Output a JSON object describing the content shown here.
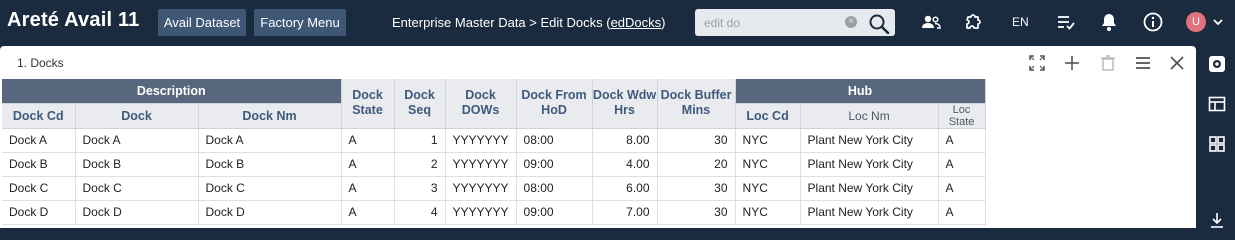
{
  "app": {
    "title": "Areté Avail 11"
  },
  "toolbar": {
    "avail_dataset": "Avail Dataset",
    "factory_menu": "Factory Menu",
    "breadcrumb_prefix": "Enterprise Master Data > Edit Docks (",
    "breadcrumb_link": "edDocks",
    "breadcrumb_suffix": ")",
    "search_placeholder": "edit do",
    "language": "EN",
    "avatar_initial": "U"
  },
  "panel": {
    "title": "1. Docks"
  },
  "grid": {
    "groups": {
      "description": "Description",
      "hub": "Hub"
    },
    "columns": {
      "dock_cd": "Dock Cd",
      "dock": "Dock",
      "dock_nm": "Dock Nm",
      "dock_state": "Dock State",
      "dock_seq": "Dock Seq",
      "dock_dows": "Dock DOWs",
      "dock_from_hod": "Dock From HoD",
      "dock_wdw_hrs": "Dock Wdw Hrs",
      "dock_buffer_mins": "Dock Buffer Mins",
      "loc_cd": "Loc Cd",
      "loc_nm": "Loc Nm",
      "loc_state": "Loc State"
    },
    "rows": [
      [
        "Dock A",
        "Dock A",
        "Dock A",
        "A",
        "1",
        "YYYYYYY",
        "08:00",
        "8.00",
        "30",
        "NYC",
        "Plant New York City",
        "A"
      ],
      [
        "Dock B",
        "Dock B",
        "Dock B",
        "A",
        "2",
        "YYYYYYY",
        "09:00",
        "4.00",
        "20",
        "NYC",
        "Plant New York City",
        "A"
      ],
      [
        "Dock C",
        "Dock C",
        "Dock C",
        "A",
        "3",
        "YYYYYYY",
        "08:00",
        "6.00",
        "30",
        "NYC",
        "Plant New York City",
        "A"
      ],
      [
        "Dock D",
        "Dock D",
        "Dock D",
        "A",
        "4",
        "YYYYYYY",
        "09:00",
        "7.00",
        "30",
        "NYC",
        "Plant New York City",
        "A"
      ]
    ]
  },
  "colors": {
    "topbar": "#1b2b3f",
    "button": "#3e5775",
    "group_header": "#56677e",
    "header_text": "#3f5a7c",
    "avatar": "#e0727f"
  }
}
